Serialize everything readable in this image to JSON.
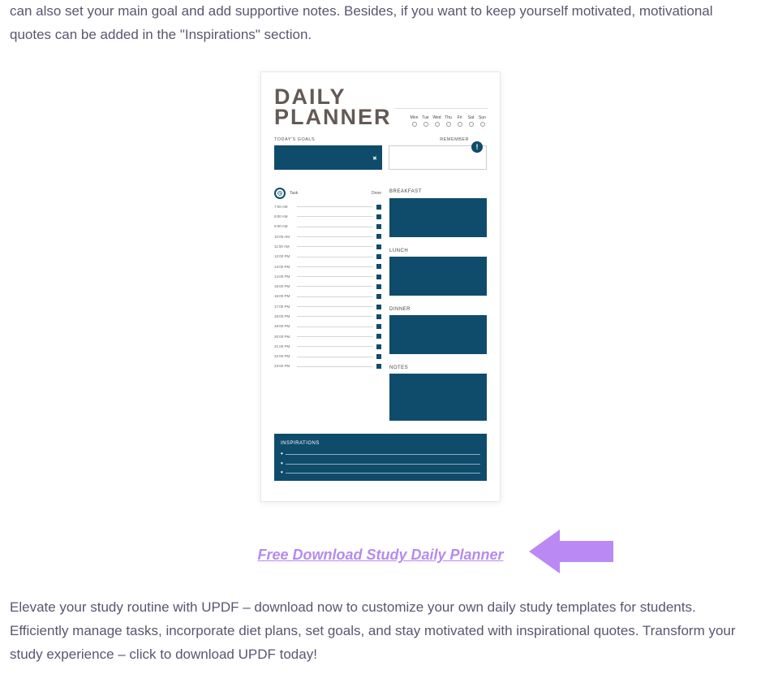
{
  "intro_text": "can also set your main goal and add supportive notes. Besides, if you want to keep yourself motivated, motivational quotes can be added in the \"Inspirations\" section.",
  "planner": {
    "title_line1": "DAILY",
    "title_line2": "PLANNER",
    "days": [
      "Mon",
      "Tue",
      "Wed",
      "Thu",
      "Fri",
      "Sat",
      "Sun"
    ],
    "goals_label": "TODAY'S GOALS",
    "remember_label": "REMEMBER",
    "excl_mark": "!",
    "sched_head_task": "Task",
    "sched_head_done": "Done",
    "times": [
      "7:00 AM",
      "8:00 AM",
      "9:00 AM",
      "10:00 AM",
      "11:00 AM",
      "12:00 PM",
      "13:00 PM",
      "14:00 PM",
      "15:00 PM",
      "16:00 PM",
      "17:00 PM",
      "18:00 PM",
      "19:00 PM",
      "20:00 PM",
      "21:00 PM",
      "22:00 PM",
      "23:00 PM"
    ],
    "meals": {
      "breakfast": "BREAKFAST",
      "lunch": "LUNCH",
      "dinner": "DINNER",
      "notes": "NOTES"
    },
    "inspirations_label": "INSPIRATIONS"
  },
  "download_link_text": "Free Download Study Daily Planner",
  "outro_text": "Elevate your study routine with UPDF – download now to customize your own daily study templates for students. Efficiently manage tasks, incorporate diet plans, set goals, and stay motivated with inspirational quotes. Transform your study experience – click to download UPDF today!"
}
